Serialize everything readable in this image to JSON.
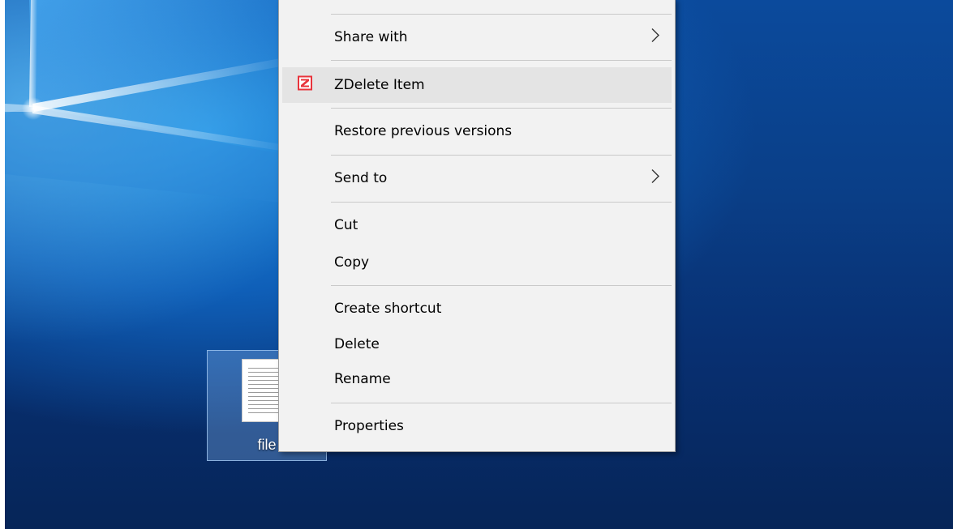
{
  "desktop": {
    "file_label": "file",
    "wallpaper": "windows-hero-wallpaper",
    "icon": "text-file-icon"
  },
  "context_menu": {
    "items": [
      {
        "label": "Share with",
        "has_submenu": true
      },
      {
        "label": "ZDelete Item",
        "icon": "zdelete-icon",
        "highlighted": true
      },
      {
        "label": "Restore previous versions"
      },
      {
        "label": "Send to",
        "has_submenu": true
      },
      {
        "label": "Cut"
      },
      {
        "label": "Copy"
      },
      {
        "label": "Create shortcut"
      },
      {
        "label": "Delete"
      },
      {
        "label": "Rename"
      },
      {
        "label": "Properties"
      }
    ]
  },
  "colors": {
    "menu_bg": "#f2f2f2",
    "menu_hover": "#e4e4e4",
    "zdelete_red": "#e8343c",
    "wallpaper_blue": "#0a3f88"
  }
}
